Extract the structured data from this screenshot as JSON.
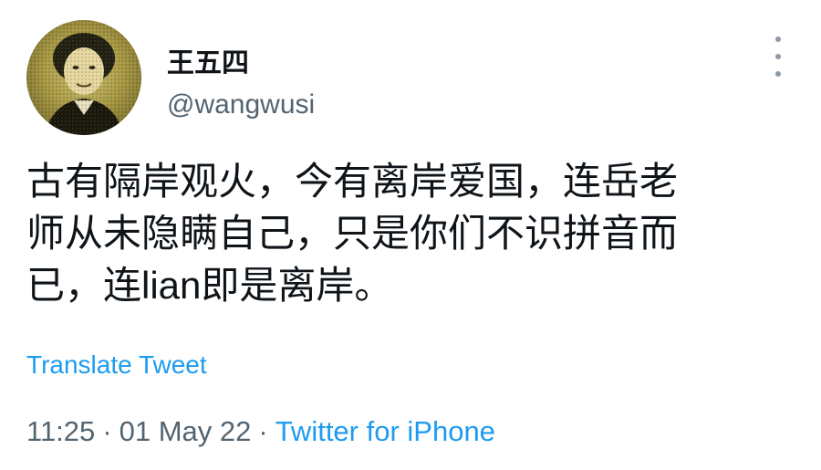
{
  "author": {
    "display_name": "王五四",
    "handle": "@wangwusi",
    "avatar_icon": "portrait-avatar"
  },
  "tweet": {
    "text": "古有隔岸观火，今有离岸爱国，连岳老\n师从未隐瞒自己，只是你们不识拼音而\n已，连lian即是离岸。",
    "translate_label": "Translate Tweet"
  },
  "meta": {
    "time": "11:25",
    "separator": "·",
    "date": "01 May 22",
    "source": "Twitter for iPhone"
  },
  "menu": {
    "more_icon": "vertical-ellipsis-icon"
  },
  "colors": {
    "link": "#1d9bf0",
    "secondary_text": "#536471",
    "primary_text": "#0f1419"
  }
}
